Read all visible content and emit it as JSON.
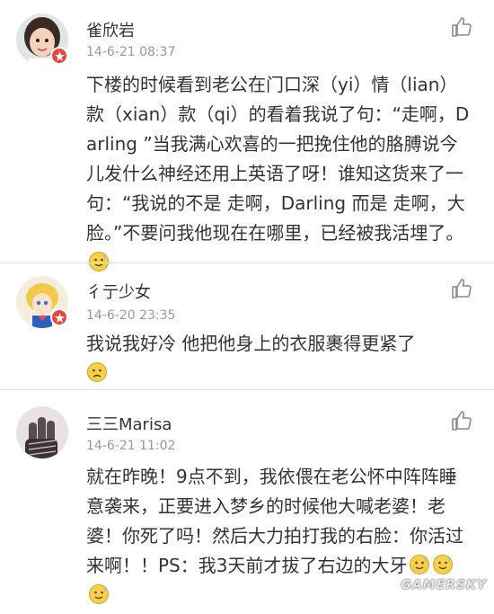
{
  "comments": [
    {
      "username": "雀欣岩",
      "time": "14-6-21 08:37",
      "text": "下楼的时候看到老公在门口深（yi）情（lian）款（xian）款（qi）的看着我说了句：“走啊，Darling ”当我满心欢喜的一把挽住他的胳膊说今儿发什么神经还用上英语了呀！谁知这货来了一句：“我说的不是 走啊，Darling 而是 走啊，大脸。”不要问我他现在在哪里，已经被我活埋了。",
      "emoji": [
        "sweat-smile-emoji"
      ]
    },
    {
      "username": "彳亍少女",
      "time": "14-6-20 23:35",
      "text": "我说我好冷 他把他身上的衣服裹得更紧了",
      "emoji": [
        "sad-emoji"
      ]
    },
    {
      "username": "三三Marisa",
      "time": "14-6-21 11:02",
      "text": "就在昨晚！9点不到，我依偎在老公怀中阵阵睡意袭来，正要进入梦乡的时候他大喊老婆！老婆！你死了吗！然后大力拍打我的右脸：你活过来啊！！PS：我3天前才拔了右边的大牙",
      "emoji": [
        "sweat-smile-emoji",
        "sweat-smile-emoji",
        "sweat-smile-emoji"
      ]
    }
  ],
  "watermark": "GAMERSKY",
  "colors": {
    "badge": "#e8463b",
    "divider": "#e2e2e2",
    "text": "#333333",
    "meta": "#999999"
  }
}
